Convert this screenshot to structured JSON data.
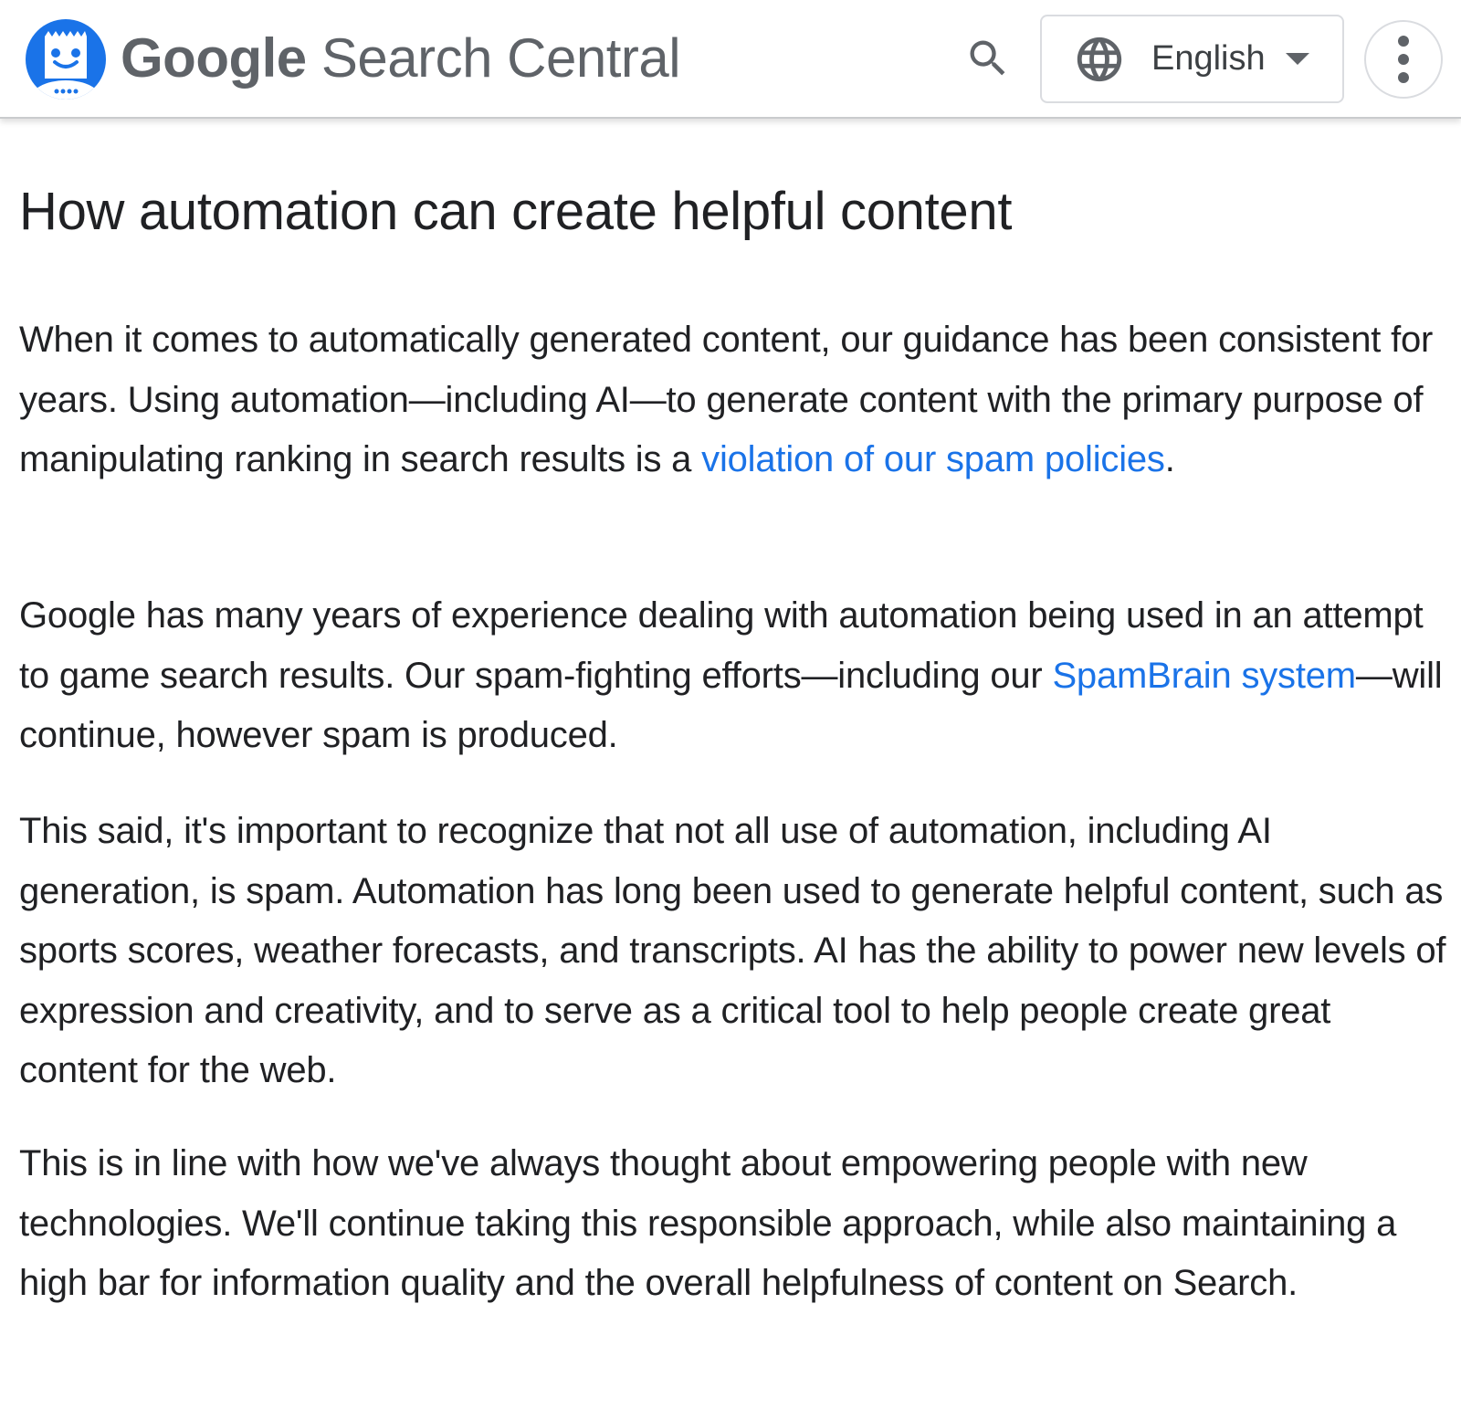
{
  "header": {
    "brand_google": "Google",
    "brand_product": "Search Central",
    "logo_icon": "search-central-robot-logo",
    "search_icon": "search-icon",
    "language": {
      "icon": "globe-icon",
      "selected": "English",
      "caret_icon": "caret-down-icon"
    },
    "more_icon": "more-vert-icon"
  },
  "colors": {
    "link": "#1a73e8",
    "logo_blue": "#1a73e8",
    "text": "#202124",
    "brand_gray": "#5f6368"
  },
  "article": {
    "title": "How automation can create helpful content",
    "paragraphs": [
      {
        "before": "When it comes to automatically generated content, our guidance has been consistent for years. Using automation—including AI—to generate content with the primary purpose of manipulating ranking in search results is a ",
        "link": "violation of our spam policies",
        "after": "."
      },
      {
        "before": "Google has many years of experience dealing with automation being used in an attempt to game search results. Our spam-fighting efforts—including our ",
        "link": "SpamBrain system",
        "after": "—will continue, however spam is produced."
      },
      {
        "text": "This said, it's important to recognize that not all use of automation, including AI generation, is spam. Automation has long been used to generate helpful content, such as sports scores, weather forecasts, and transcripts. AI has the ability to power new levels of expression and creativity, and to serve as a critical tool to help people create great content for the web."
      },
      {
        "text": "This is in line with how we've always thought about empowering people with new technologies. We'll continue taking this responsible approach, while also maintaining a high bar for information quality and the overall helpfulness of content on Search."
      }
    ]
  }
}
